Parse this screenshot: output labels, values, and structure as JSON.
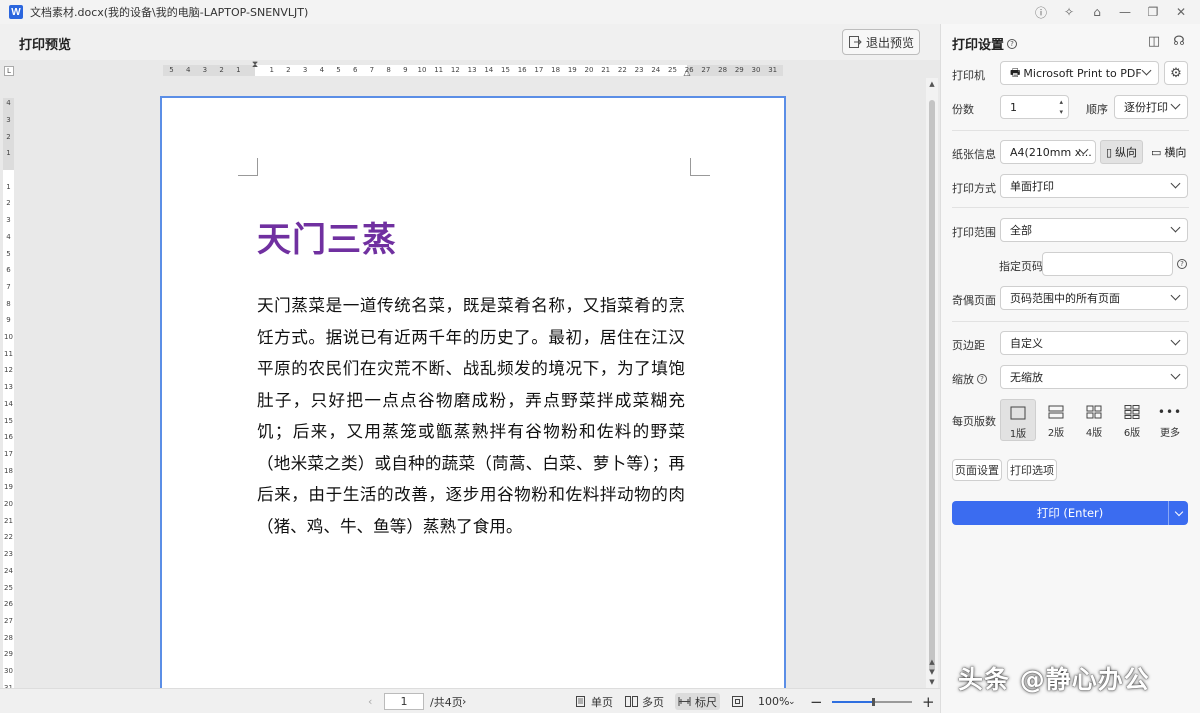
{
  "window": {
    "title": "文档素材.docx(我的设备\\我的电脑-LAPTOP-SNENVLJT)",
    "logo": "W"
  },
  "toolbar": {
    "title": "打印预览",
    "exit_label": "退出预览"
  },
  "ruler": {
    "corner": "L",
    "h_left": [
      "5",
      "4",
      "3",
      "2",
      "1"
    ],
    "h_main": [
      "1",
      "2",
      "3",
      "4",
      "5",
      "6",
      "7",
      "8",
      "9",
      "10",
      "11",
      "12",
      "13",
      "14",
      "15",
      "16",
      "17",
      "18",
      "19",
      "20",
      "21",
      "22",
      "23",
      "24",
      "25",
      "26"
    ],
    "h_right": [
      "27",
      "28",
      "29",
      "30",
      "31"
    ],
    "v_top": [
      "4",
      "3",
      "2",
      "1"
    ],
    "v_main": [
      "1",
      "2",
      "3",
      "4",
      "5",
      "6",
      "7",
      "8",
      "9",
      "10",
      "11",
      "12",
      "13",
      "14",
      "15",
      "16",
      "17",
      "18",
      "19",
      "20",
      "21",
      "22",
      "23",
      "24",
      "25",
      "26",
      "27",
      "28",
      "29",
      "30",
      "31"
    ]
  },
  "document": {
    "title": "天门三蒸",
    "title_color": "#7030a0",
    "body": "天门蒸菜是一道传统名菜，既是菜肴名称，又指菜肴的烹饪方式。据说已有近两千年的历史了。最初，居住在江汉平原的农民们在灾荒不断、战乱频发的境况下，为了填饱肚子，只好把一点点谷物磨成粉，弄点野菜拌成菜糊充饥；后来，又用蒸笼或甑蒸熟拌有谷物粉和佐料的野菜（地米菜之类）或自种的蔬菜（茼蒿、白菜、萝卜等）；再后来，由于生活的改善，逐步用谷物粉和佐料拌动物的肉（猪、鸡、牛、鱼等）蒸熟了食用。"
  },
  "statusbar": {
    "page_current": "1",
    "page_total": "/共4页",
    "single_page": "单页",
    "multi_page": "多页",
    "ruler": "标尺",
    "zoom": "100%",
    "zoom_level": 0.5
  },
  "panel": {
    "title": "打印设置",
    "printer_label": "打印机",
    "printer_value": "Microsoft Print to PDF",
    "copies_label": "份数",
    "copies_value": "1",
    "order_label": "顺序",
    "order_value": "逐份打印",
    "paper_label": "纸张信息",
    "paper_value": "A4(210mm x...",
    "portrait": "纵向",
    "landscape": "横向",
    "mode_label": "打印方式",
    "mode_value": "单面打印",
    "range_label": "打印范围",
    "range_value": "全部",
    "pages_label": "指定页码",
    "pages_value": "",
    "oddeven_label": "奇偶页面",
    "oddeven_value": "页码范围中的所有页面",
    "margin_label": "页边距",
    "margin_value": "自定义",
    "scale_label": "缩放",
    "scale_value": "无缩放",
    "persheet_label": "每页版数",
    "layouts": [
      "1版",
      "2版",
      "4版",
      "6版",
      "更多"
    ],
    "page_setup": "页面设置",
    "print_options": "打印选项",
    "print_button": "打印 (Enter)",
    "accent": "#3b6cf0"
  },
  "watermark": "头条 @静心办公"
}
